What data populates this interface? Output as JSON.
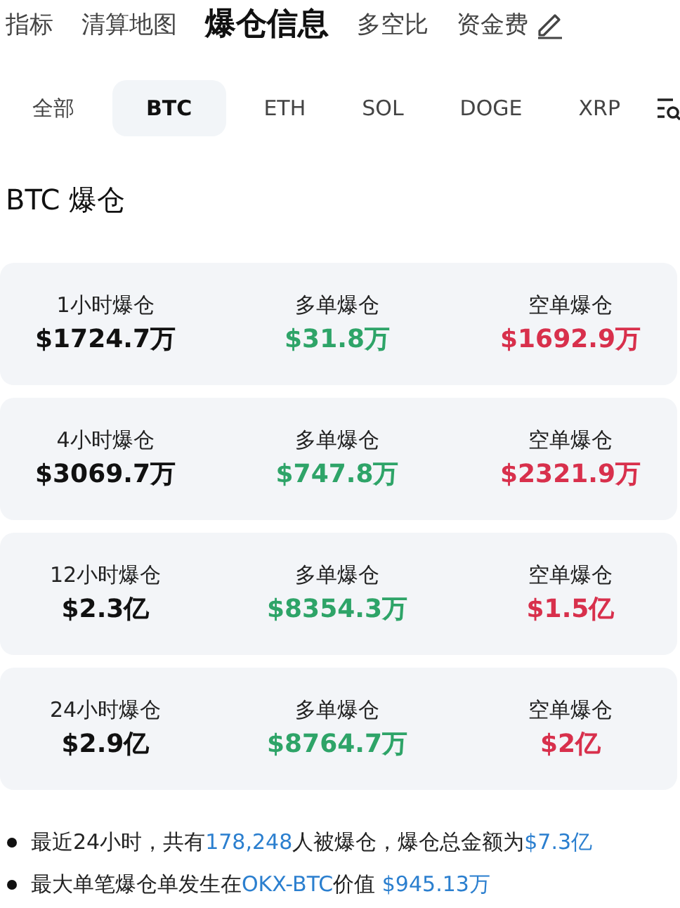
{
  "top_tabs": [
    {
      "label": "指标",
      "selected": false
    },
    {
      "label": "清算地图",
      "selected": false
    },
    {
      "label": "爆仓信息",
      "selected": true
    },
    {
      "label": "多空比",
      "selected": false
    },
    {
      "label": "资金费",
      "selected": false
    }
  ],
  "coin_tabs": [
    {
      "label": "全部",
      "selected": false
    },
    {
      "label": "BTC",
      "selected": true
    },
    {
      "label": "ETH",
      "selected": false
    },
    {
      "label": "SOL",
      "selected": false
    },
    {
      "label": "DOGE",
      "selected": false
    },
    {
      "label": "XRP",
      "selected": false
    }
  ],
  "section_title": "BTC 爆仓",
  "cards": [
    {
      "cells": [
        {
          "label": "1小时爆仓",
          "value": "$1724.7万",
          "kind": "total"
        },
        {
          "label": "多单爆仓",
          "value": "$31.8万",
          "kind": "long"
        },
        {
          "label": "空单爆仓",
          "value": "$1692.9万",
          "kind": "short"
        }
      ]
    },
    {
      "cells": [
        {
          "label": "4小时爆仓",
          "value": "$3069.7万",
          "kind": "total"
        },
        {
          "label": "多单爆仓",
          "value": "$747.8万",
          "kind": "long"
        },
        {
          "label": "空单爆仓",
          "value": "$2321.9万",
          "kind": "short"
        }
      ]
    },
    {
      "cells": [
        {
          "label": "12小时爆仓",
          "value": "$2.3亿",
          "kind": "total"
        },
        {
          "label": "多单爆仓",
          "value": "$8354.3万",
          "kind": "long"
        },
        {
          "label": "空单爆仓",
          "value": "$1.5亿",
          "kind": "short"
        }
      ]
    },
    {
      "cells": [
        {
          "label": "24小时爆仓",
          "value": "$2.9亿",
          "kind": "total"
        },
        {
          "label": "多单爆仓",
          "value": "$8764.7万",
          "kind": "long"
        },
        {
          "label": "空单爆仓",
          "value": "$2亿",
          "kind": "short"
        }
      ]
    }
  ],
  "notes": [
    {
      "parts": [
        {
          "text": "最近24小时，共有",
          "highlight": false
        },
        {
          "text": "178,248",
          "highlight": true
        },
        {
          "text": "人被爆仓，爆仓总金额为",
          "highlight": false
        },
        {
          "text": "$7.3亿",
          "highlight": true
        }
      ]
    },
    {
      "parts": [
        {
          "text": "最大单笔爆仓单发生在",
          "highlight": false
        },
        {
          "text": "OKX-BTC",
          "highlight": true
        },
        {
          "text": "价值 ",
          "highlight": false
        },
        {
          "text": "$945.13万",
          "highlight": true
        }
      ]
    }
  ]
}
